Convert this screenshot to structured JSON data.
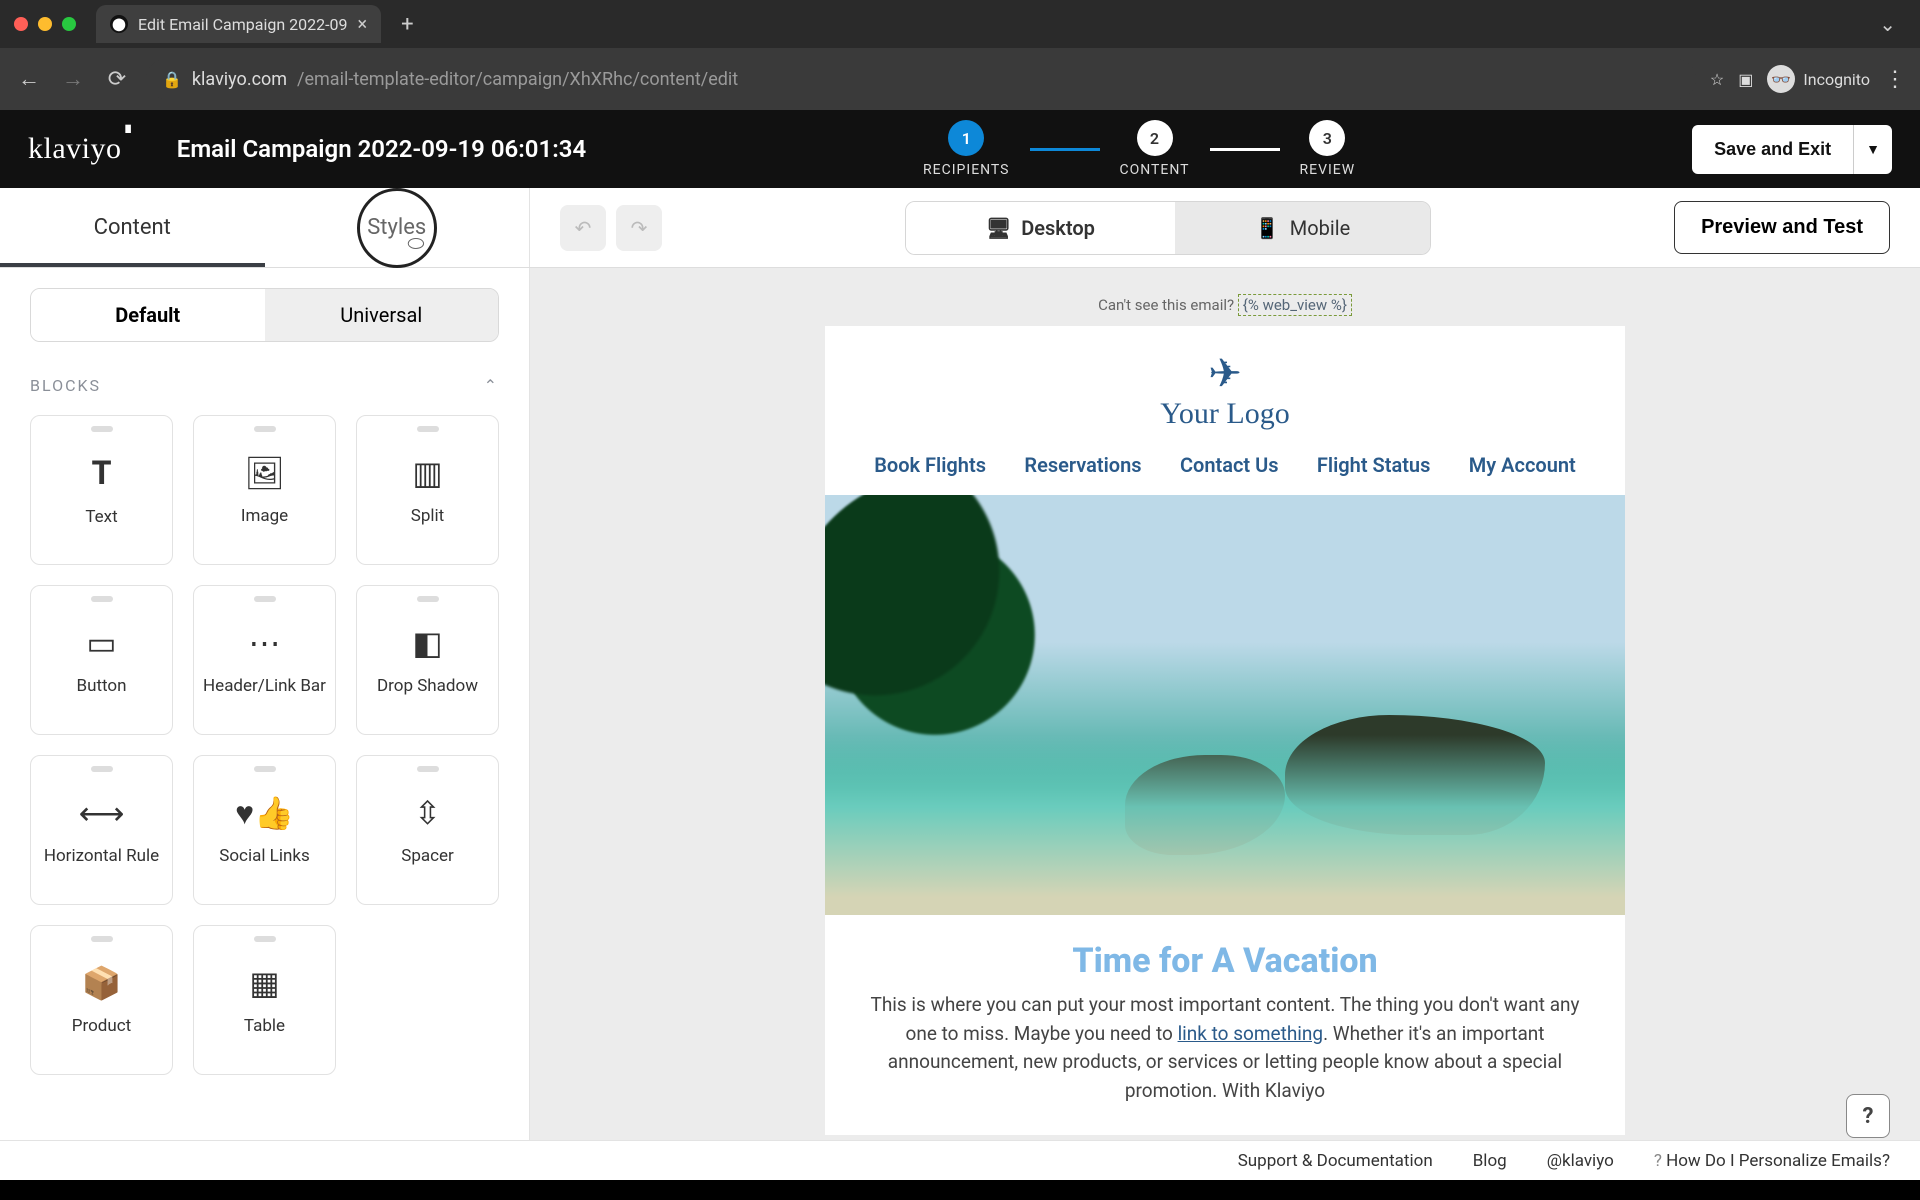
{
  "browser": {
    "tab_title": "Edit Email Campaign 2022-09",
    "url_host": "klaviyo.com",
    "url_path": "/email-template-editor/campaign/XhXRhc/content/edit",
    "incognito_label": "Incognito"
  },
  "header": {
    "logo": "klaviyo",
    "campaign_title": "Email Campaign 2022-09-19 06:01:34",
    "steps": {
      "s1": {
        "num": "1",
        "label": "RECIPIENTS"
      },
      "s2": {
        "num": "2",
        "label": "CONTENT"
      },
      "s3": {
        "num": "3",
        "label": "REVIEW"
      }
    },
    "save_label": "Save and Exit"
  },
  "toolbar": {
    "tab_content": "Content",
    "tab_styles": "Styles",
    "device_desktop": "Desktop",
    "device_mobile": "Mobile",
    "preview_label": "Preview and Test"
  },
  "sidebar": {
    "seg_default": "Default",
    "seg_universal": "Universal",
    "section_blocks": "BLOCKS",
    "blocks": [
      {
        "label": "Text",
        "icon": "𝐓"
      },
      {
        "label": "Image",
        "icon": "🖼"
      },
      {
        "label": "Split",
        "icon": "▥"
      },
      {
        "label": "Button",
        "icon": "▭"
      },
      {
        "label": "Header/Link Bar",
        "icon": "⋯"
      },
      {
        "label": "Drop Shadow",
        "icon": "◧"
      },
      {
        "label": "Horizontal Rule",
        "icon": "⟷"
      },
      {
        "label": "Social Links",
        "icon": "♥👍"
      },
      {
        "label": "Spacer",
        "icon": "⇳"
      },
      {
        "label": "Product",
        "icon": "📦"
      },
      {
        "label": "Table",
        "icon": "▦"
      }
    ]
  },
  "canvas": {
    "cant_see_text": "Can't see this email? ",
    "cant_see_tag": "{% web_view %}",
    "logo_text": "Your Logo",
    "nav": [
      "Book Flights",
      "Reservations",
      "Contact Us",
      "Flight Status",
      "My Account"
    ],
    "headline": "Time for A Vacation",
    "body_pre": "This is where you can put your most important content. The thing you don't want any one to miss. Maybe you need to ",
    "body_link": "link to something",
    "body_post": ". Whether it's an important announcement, new products, or services or letting people know about a special promotion. With Klaviyo"
  },
  "footer": {
    "support": "Support & Documentation",
    "blog": "Blog",
    "twitter": "@klaviyo",
    "help": "How Do I Personalize Emails?"
  }
}
